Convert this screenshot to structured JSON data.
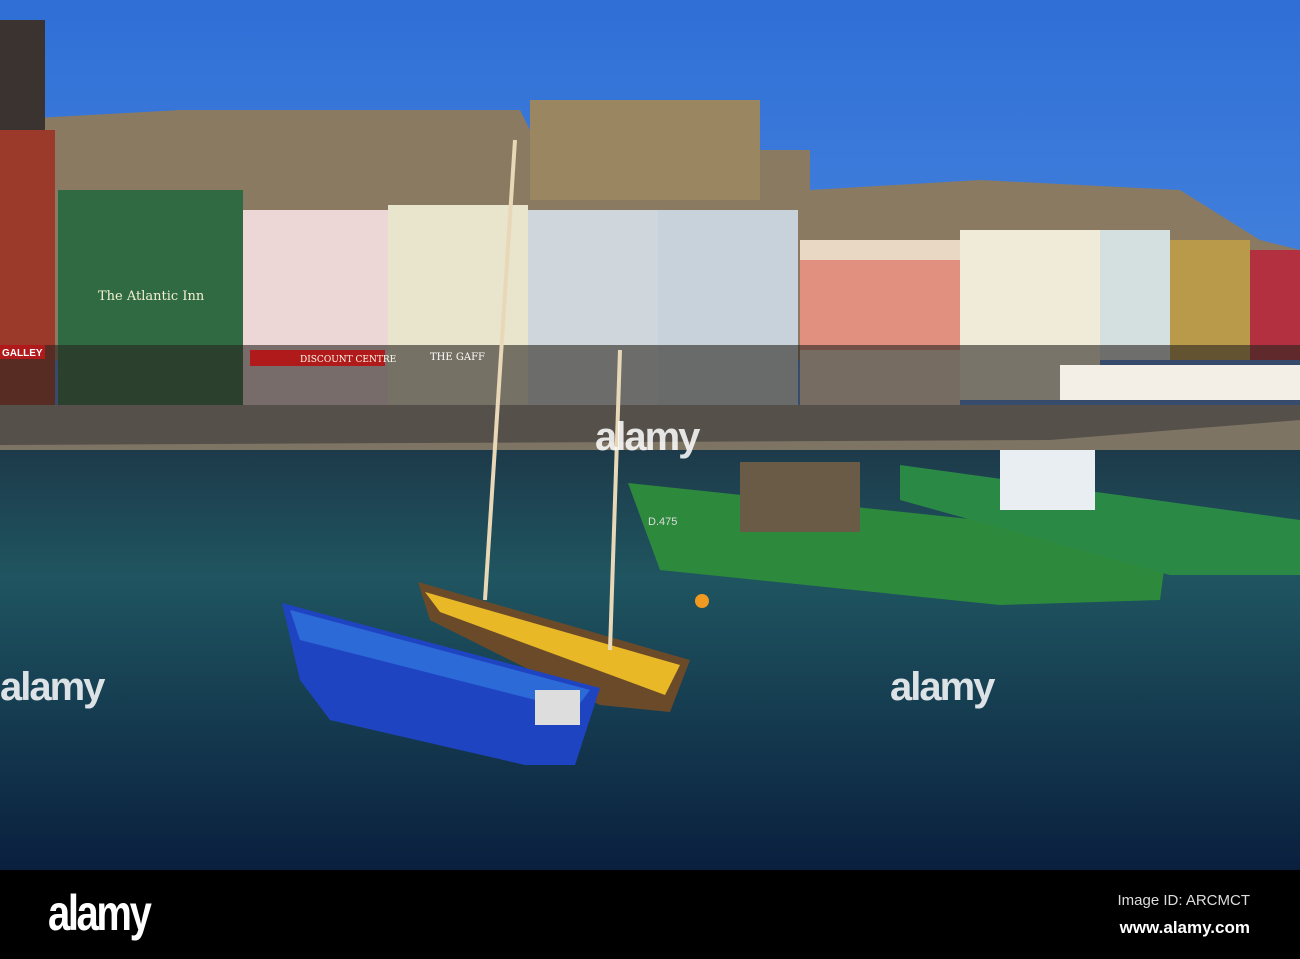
{
  "photo": {
    "signs": {
      "atlantic_inn": "The Atlantic Inn",
      "discount": "DISCOUNT CENTRE",
      "gaff": "THE GAFF",
      "galley": "GALLEY",
      "boat_reg": "D.475"
    }
  },
  "watermark": {
    "text": "alamy"
  },
  "footer": {
    "logo": "alamy",
    "image_id": "Image ID: ARCMCT",
    "website": "www.alamy.com"
  }
}
